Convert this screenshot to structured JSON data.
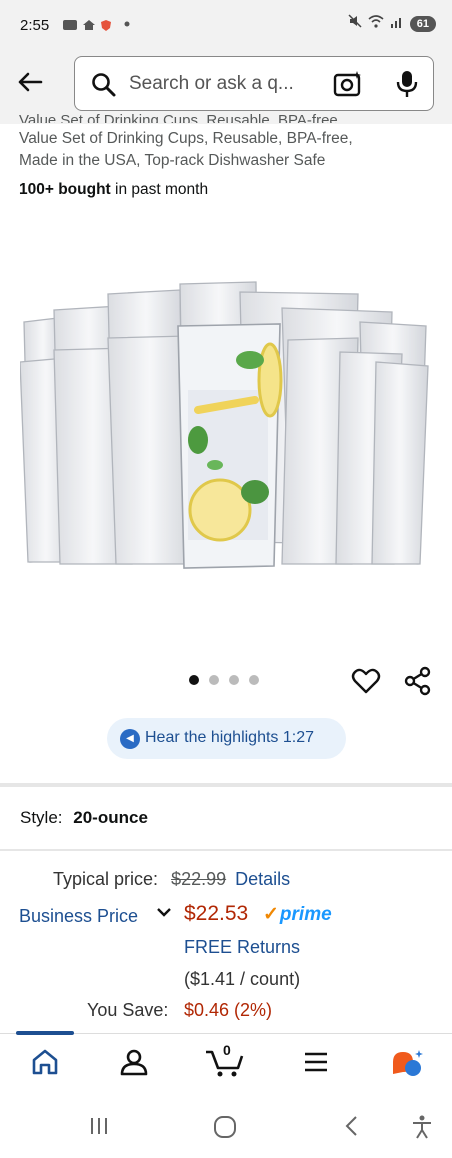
{
  "status_bar": {
    "time": "2:55",
    "battery": "61"
  },
  "search": {
    "placeholder": "Search or ask a q..."
  },
  "product": {
    "title_cut": "Value Set of Drinking Cups, Reusable, BPA-free,",
    "title_lines": [
      "Value Set of Drinking Cups, Reusable, BPA-free,",
      "Made in the USA, Top-rack Dishwasher Safe"
    ],
    "bought_bold": "100+ bought",
    "bought_rest": "in past month"
  },
  "gallery": {
    "dots": 4,
    "active_index": 0
  },
  "highlights": {
    "label": "Hear the highlights 1:27"
  },
  "style": {
    "label": "Style:",
    "value": "20-ounce"
  },
  "pricing": {
    "typical_label": "Typical price:",
    "typical_price": "$22.99",
    "details_link": "Details",
    "business_label": "Business Price",
    "price": "$22.53",
    "prime_label": "prime",
    "free_returns": "FREE Returns",
    "per_count": "($1.41 / count)",
    "save_label": "You Save:",
    "save_value": "$0.46 (2%)"
  },
  "bottom_nav": {
    "cart_count": "0"
  },
  "colors": {
    "accent_blue": "#1d4f91",
    "price_red": "#b12704",
    "prime_blue": "#1a98ff"
  }
}
